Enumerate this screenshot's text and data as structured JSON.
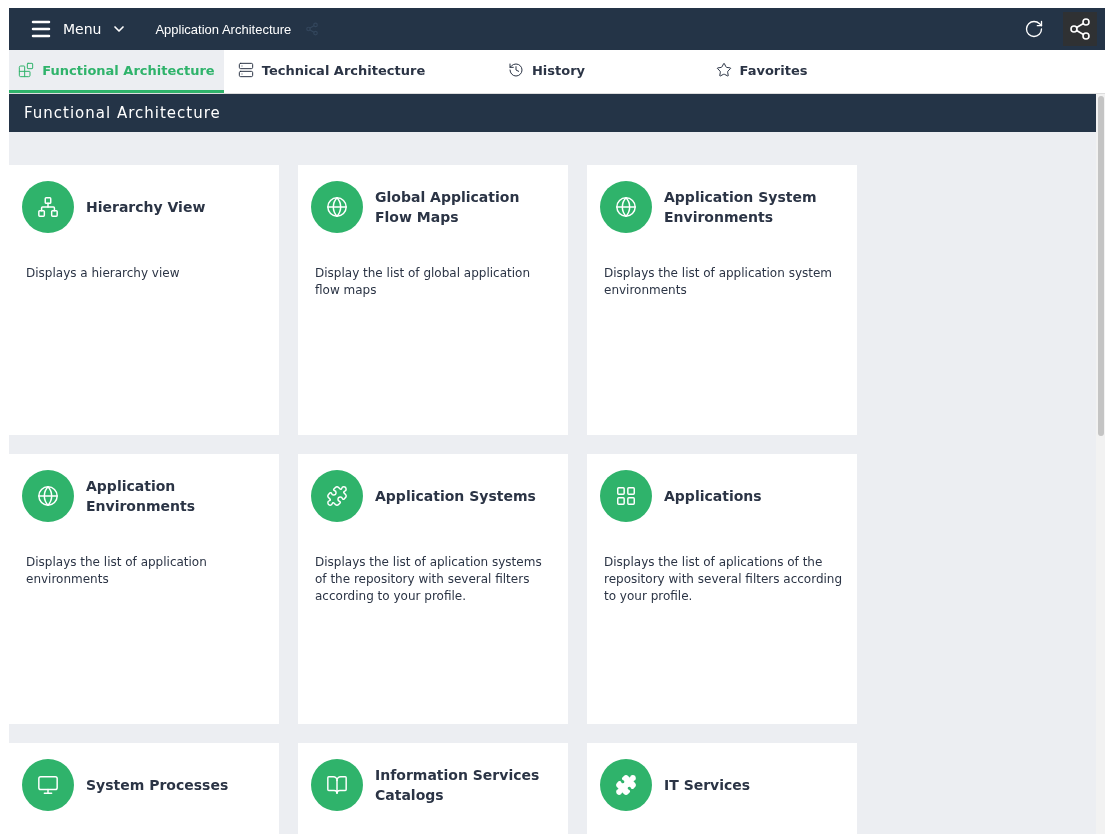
{
  "topbar": {
    "menu_label": "Menu",
    "breadcrumb": "Application Architecture"
  },
  "tabs": [
    {
      "label": "Functional Architecture",
      "kind": "functional",
      "selected": true
    },
    {
      "label": "Technical Architecture",
      "kind": "technical",
      "selected": false
    },
    {
      "label": "History",
      "kind": "history",
      "selected": false
    },
    {
      "label": "Favorites",
      "kind": "favorites",
      "selected": false
    }
  ],
  "section": {
    "title": "Functional Architecture"
  },
  "cards": [
    {
      "title": "Hierarchy View",
      "description": "Displays a hierarchy view",
      "kind": "hierarchy"
    },
    {
      "title": "Global Application Flow Maps",
      "description": "Display the list of global application flow maps",
      "kind": "globe"
    },
    {
      "title": "Application System Environments",
      "description": "Displays the list of application system environments",
      "kind": "globe"
    },
    {
      "title": "Application Environments",
      "description": "Displays the list of application environments",
      "kind": "globe"
    },
    {
      "title": "Application Systems",
      "description": "Displays the list of aplication systems of the repository with several filters according to your profile.",
      "kind": "system"
    },
    {
      "title": "Applications",
      "description": "Displays the list of aplications of the repository with several filters according to your profile.",
      "kind": "apps"
    },
    {
      "title": "System Processes",
      "kind": "monitor"
    },
    {
      "title": "Information Services Catalogs",
      "kind": "book"
    },
    {
      "title": "IT Services",
      "kind": "puzzle"
    }
  ]
}
